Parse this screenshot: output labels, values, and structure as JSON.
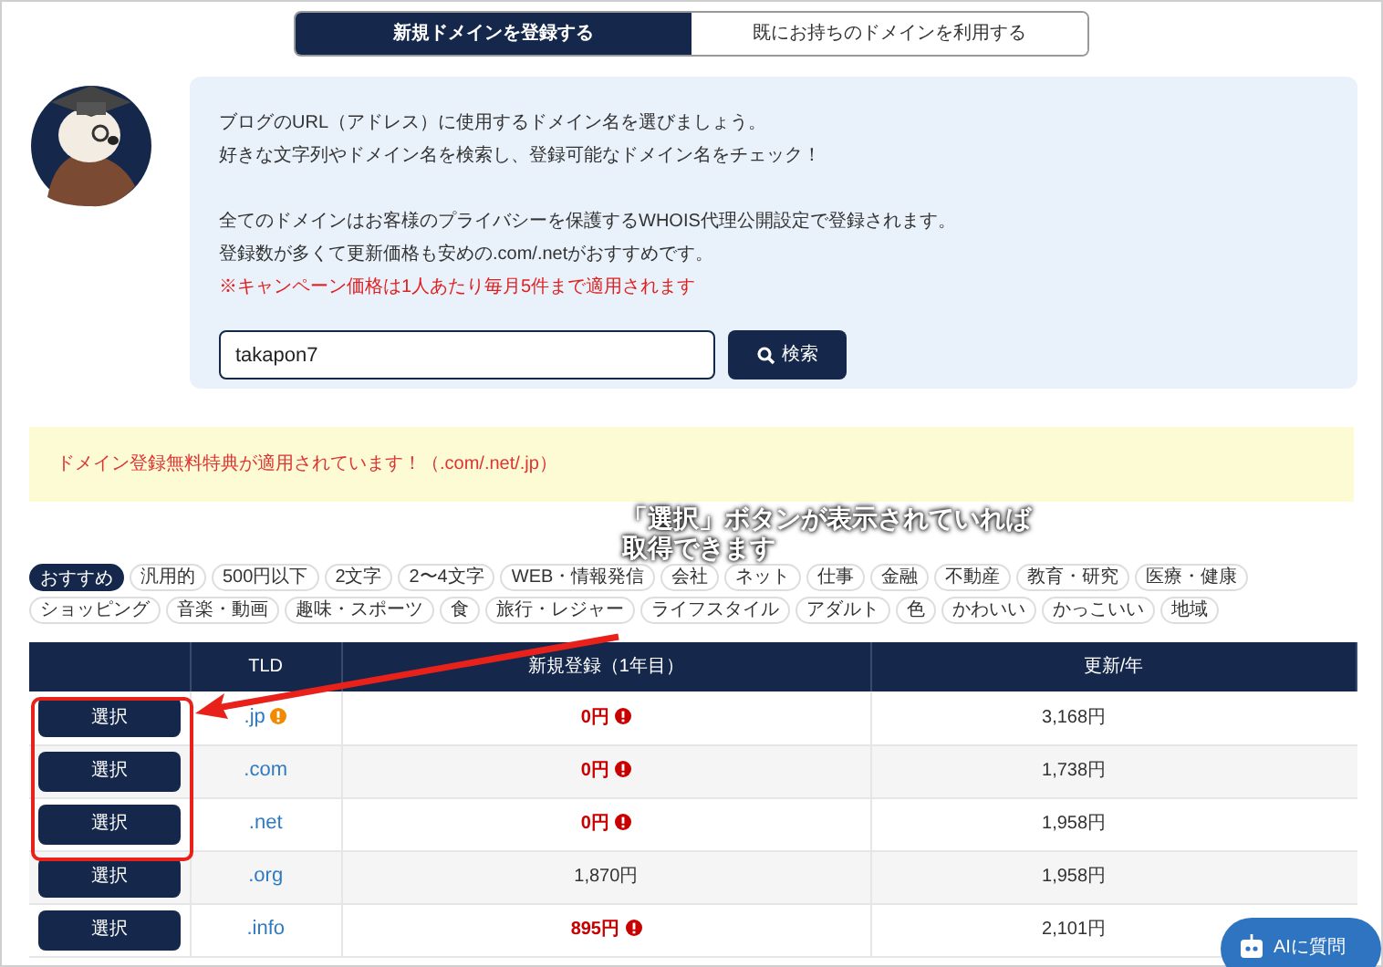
{
  "tabs": [
    {
      "label": "新規ドメインを登録する",
      "selected": true
    },
    {
      "label": "既にお持ちのドメインを利用する",
      "selected": false
    }
  ],
  "intro": {
    "lines": [
      "ブログのURL（アドレス）に使用するドメイン名を選びましょう。",
      "好きな文字列やドメイン名を検索し、登録可能なドメイン名をチェック！"
    ],
    "notes": [
      "全てのドメインはお客様のプライバシーを保護するWHOIS代理公開設定で登録されます。",
      "登録数が多くて更新価格も安めの.com/.netがおすすめです。"
    ],
    "warning": "※キャンペーン価格は1人あたり毎月5件まで適用されます"
  },
  "search": {
    "value": "takapon7",
    "button": "検索"
  },
  "notice": "ドメイン登録無料特典が適用されています！（.com/.net/.jp）",
  "annotation": [
    "「選択」ボタンが表示されていれば",
    "取得できます"
  ],
  "tags": [
    {
      "label": "おすすめ",
      "selected": true
    },
    {
      "label": "汎用的",
      "selected": false
    },
    {
      "label": "500円以下",
      "selected": false
    },
    {
      "label": "2文字",
      "selected": false
    },
    {
      "label": "2〜4文字",
      "selected": false
    },
    {
      "label": "WEB・情報発信",
      "selected": false
    },
    {
      "label": "会社",
      "selected": false
    },
    {
      "label": "ネット",
      "selected": false
    },
    {
      "label": "仕事",
      "selected": false
    },
    {
      "label": "金融",
      "selected": false
    },
    {
      "label": "不動産",
      "selected": false
    },
    {
      "label": "教育・研究",
      "selected": false
    },
    {
      "label": "医療・健康",
      "selected": false
    },
    {
      "label": "ショッピング",
      "selected": false
    },
    {
      "label": "音楽・動画",
      "selected": false
    },
    {
      "label": "趣味・スポーツ",
      "selected": false
    },
    {
      "label": "食",
      "selected": false
    },
    {
      "label": "旅行・レジャー",
      "selected": false
    },
    {
      "label": "ライフスタイル",
      "selected": false
    },
    {
      "label": "アダルト",
      "selected": false
    },
    {
      "label": "色",
      "selected": false
    },
    {
      "label": "かわいい",
      "selected": false
    },
    {
      "label": "かっこいい",
      "selected": false
    },
    {
      "label": "地域",
      "selected": false
    }
  ],
  "table": {
    "columns": [
      "TLD",
      "新規登録（1年目）",
      "更新/年"
    ],
    "rows": [
      {
        "button": "選択",
        "tld": ".jp",
        "tld_note": true,
        "price": "0円",
        "campaign": true,
        "renewal": "3,168円"
      },
      {
        "button": "選択",
        "tld": ".com",
        "tld_note": false,
        "price": "0円",
        "campaign": true,
        "renewal": "1,738円"
      },
      {
        "button": "選択",
        "tld": ".net",
        "tld_note": false,
        "price": "0円",
        "campaign": true,
        "renewal": "1,958円"
      },
      {
        "button": "選択",
        "tld": ".org",
        "tld_note": false,
        "price": "1,870円",
        "campaign": false,
        "renewal": "1,958円"
      },
      {
        "button": "選択",
        "tld": ".info",
        "tld_note": false,
        "price": "895円",
        "campaign": true,
        "renewal": "2,101円"
      }
    ]
  },
  "chat_button": "AIに質問"
}
